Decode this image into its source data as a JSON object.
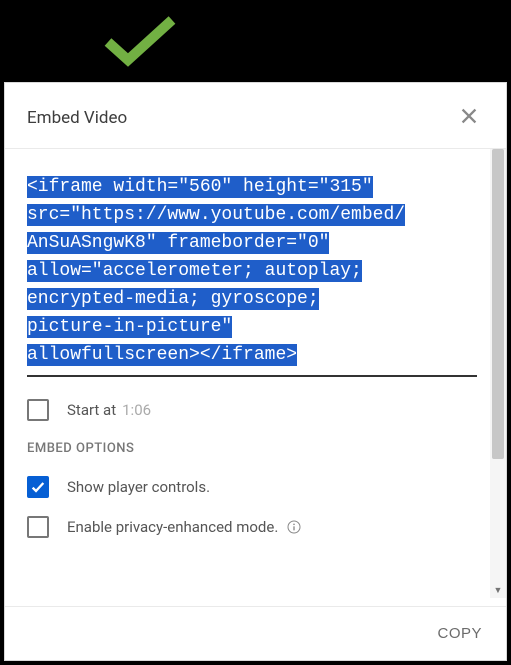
{
  "dialog": {
    "title": "Embed Video",
    "embed_code_lines": [
      "<iframe width=\"560\" height=\"315\"",
      "src=\"https://www.youtube.com/embed/",
      "AnSuASngwK8\" frameborder=\"0\"",
      "allow=\"accelerometer; autoplay;",
      "encrypted-media; gyroscope;",
      "picture-in-picture\"",
      "allowfullscreen></iframe>"
    ],
    "start_at": {
      "label": "Start at",
      "time": "1:06",
      "checked": false
    },
    "embed_options": {
      "heading": "EMBED OPTIONS",
      "items": [
        {
          "label": "Show player controls.",
          "checked": true,
          "info": false
        },
        {
          "label": "Enable privacy-enhanced mode.",
          "checked": false,
          "info": true
        }
      ]
    },
    "copy_label": "COPY"
  },
  "colors": {
    "highlight": "#1f5ec9",
    "check_green": "#72b043",
    "checkbox_blue": "#065fd4"
  }
}
